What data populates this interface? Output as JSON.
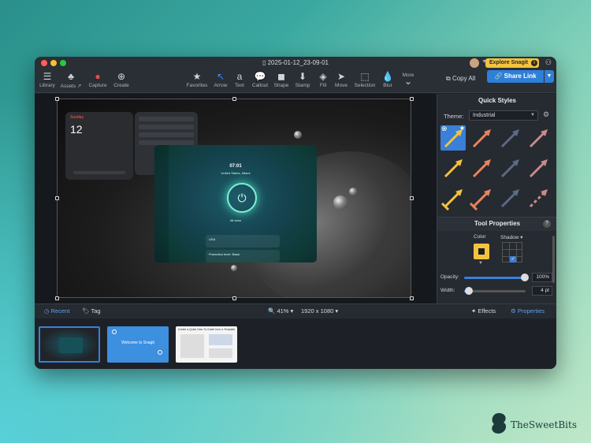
{
  "window": {
    "title": "2025-01-12_23-09-01",
    "explore_label": "Explore Snagit",
    "explore_info": "i"
  },
  "toolbar": {
    "left": [
      {
        "name": "library",
        "label": "Library",
        "icon": "☰"
      },
      {
        "name": "assets",
        "label": "Assets ↗",
        "icon": "♣"
      },
      {
        "name": "capture",
        "label": "Capture",
        "icon": "●"
      },
      {
        "name": "create",
        "label": "Create",
        "icon": "⊕"
      }
    ],
    "tools": [
      {
        "name": "favorites",
        "label": "Favorites",
        "icon": "★"
      },
      {
        "name": "arrow",
        "label": "Arrow",
        "icon": "↖"
      },
      {
        "name": "text",
        "label": "Text",
        "icon": "a"
      },
      {
        "name": "callout",
        "label": "Callout",
        "icon": "💬"
      },
      {
        "name": "shape",
        "label": "Shape",
        "icon": "◼"
      },
      {
        "name": "stamp",
        "label": "Stamp",
        "icon": "⬇"
      },
      {
        "name": "fill",
        "label": "Fill",
        "icon": "◈"
      },
      {
        "name": "move",
        "label": "Move",
        "icon": "➤"
      },
      {
        "name": "selection",
        "label": "Selection",
        "icon": "⬚"
      },
      {
        "name": "blur",
        "label": "Blur",
        "icon": "💧"
      },
      {
        "name": "more",
        "label": "More",
        "icon": "⌄"
      }
    ],
    "copy_all": "Copy All",
    "share_link": "Share Link"
  },
  "capture_preview": {
    "calendar_day": "Sunday",
    "calendar_date": "12",
    "vpn_time": "07:01",
    "vpn_location": "United States, Miami",
    "vpn_status": "All clear",
    "vpn_card1": "USA",
    "vpn_card2": "Protection level: Basic"
  },
  "sidebar": {
    "quick_styles_title": "Quick Styles",
    "theme_label": "Theme:",
    "theme_value": "Industrial",
    "tool_properties_title": "Tool Properties",
    "help": "?",
    "color_label": "Color",
    "shadow_label": "Shadow ▾",
    "opacity_label": "Opacity:",
    "opacity_value": "100%",
    "opacity_fraction": 1.0,
    "width_label": "Width:",
    "width_value": "4 pt",
    "width_fraction": 0.08
  },
  "quick_styles": [
    {
      "color": "#f3c33d",
      "selected": true
    },
    {
      "color": "#e8855a"
    },
    {
      "color": "#5c6a85"
    },
    {
      "color": "#c98a8a"
    },
    {
      "color": "#f3c33d"
    },
    {
      "color": "#e8855a"
    },
    {
      "color": "#5c6a85"
    },
    {
      "color": "#c98a8a"
    },
    {
      "color": "#f3c33d"
    },
    {
      "color": "#e8855a"
    },
    {
      "color": "#5c6a85"
    },
    {
      "color": "#c98a8a"
    }
  ],
  "bottombar": {
    "recent": "Recent",
    "tag": "Tag",
    "zoom": "41%",
    "dimensions": "1920 x 1080",
    "effects": "Effects",
    "properties": "Properties"
  },
  "thumbnails": [
    {
      "name": "thumb-vpn-capture",
      "selected": true
    },
    {
      "name": "thumb-welcome",
      "text": "Welcome to Snagit"
    },
    {
      "name": "thumb-guide",
      "text": "Create a Quick How-To Guide from a Template"
    }
  ],
  "watermark": "TheSweetBits",
  "colors": {
    "accent": "#3a7fd8",
    "explore": "#f3c33d",
    "share": "#2e7fd8"
  }
}
